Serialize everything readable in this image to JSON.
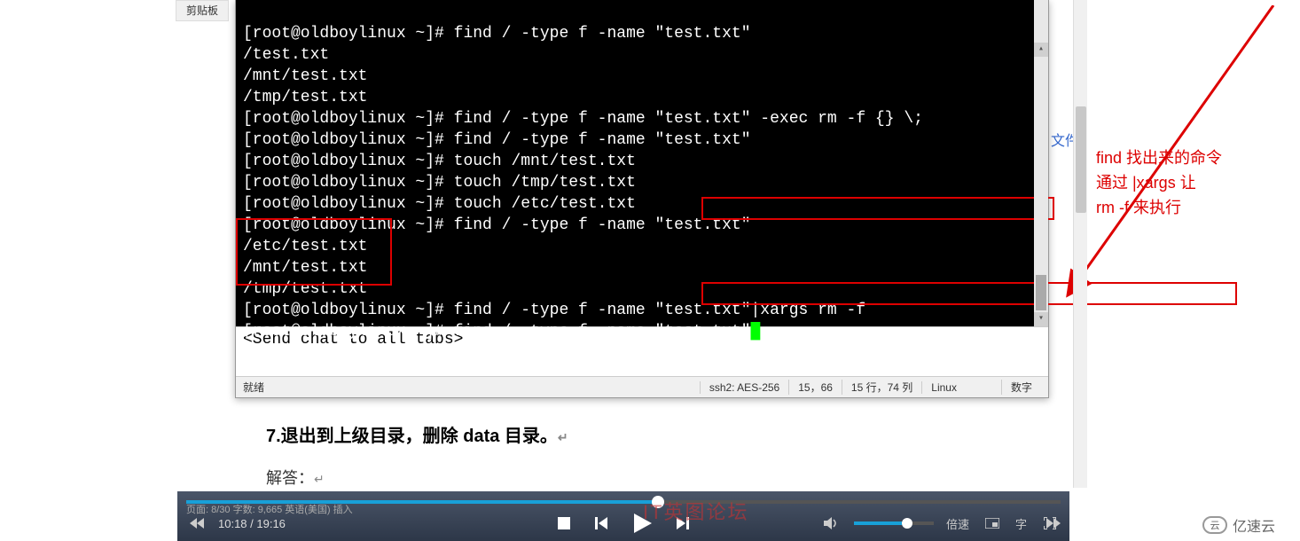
{
  "left_sidebar_label": "剪贴板",
  "terminal": {
    "lines": [
      "[root@oldboylinux ~]# find / -type f -name \"test.txt\"",
      "/test.txt",
      "/mnt/test.txt",
      "/tmp/test.txt",
      "[root@oldboylinux ~]# find / -type f -name \"test.txt\" -exec rm -f {} \\;",
      "[root@oldboylinux ~]# find / -type f -name \"test.txt\"",
      "[root@oldboylinux ~]# touch /mnt/test.txt",
      "[root@oldboylinux ~]# touch /tmp/test.txt",
      "[root@oldboylinux ~]# touch /etc/test.txt",
      "[root@oldboylinux ~]# find / -type f -name \"test.txt\"",
      "/etc/test.txt",
      "/mnt/test.txt",
      "/tmp/test.txt",
      "[root@oldboylinux ~]# find / -type f -name \"test.txt\"|xargs rm -f",
      "[root@oldboylinux ~]# find / -type f -name \"test.txt\""
    ],
    "chat_placeholder": "<Send chat to all tabs>"
  },
  "status": {
    "ready": "就绪",
    "ssh": "ssh2: AES-256",
    "pos": "15，66",
    "dim": "15 行，74 列",
    "os": "Linux",
    "num": "数字"
  },
  "annotation": {
    "l1": "find 找出来的命令",
    "l2": "通过 |xargs 让",
    "l3": "rm -f 来执行"
  },
  "doc": {
    "heading": "7.退出到上级目录，删除 data 目录。",
    "answer_label": "解答：",
    "bg_partial": "文件"
  },
  "video": {
    "time": "10:18 / 19:16",
    "speed_label": "倍速",
    "caption_label": "字",
    "footer_left": "页面: 8/30   字数: 9,665   英语(美国)   插入"
  },
  "watermark_text": "亿速云",
  "overlay_red": "IT英图论坛"
}
